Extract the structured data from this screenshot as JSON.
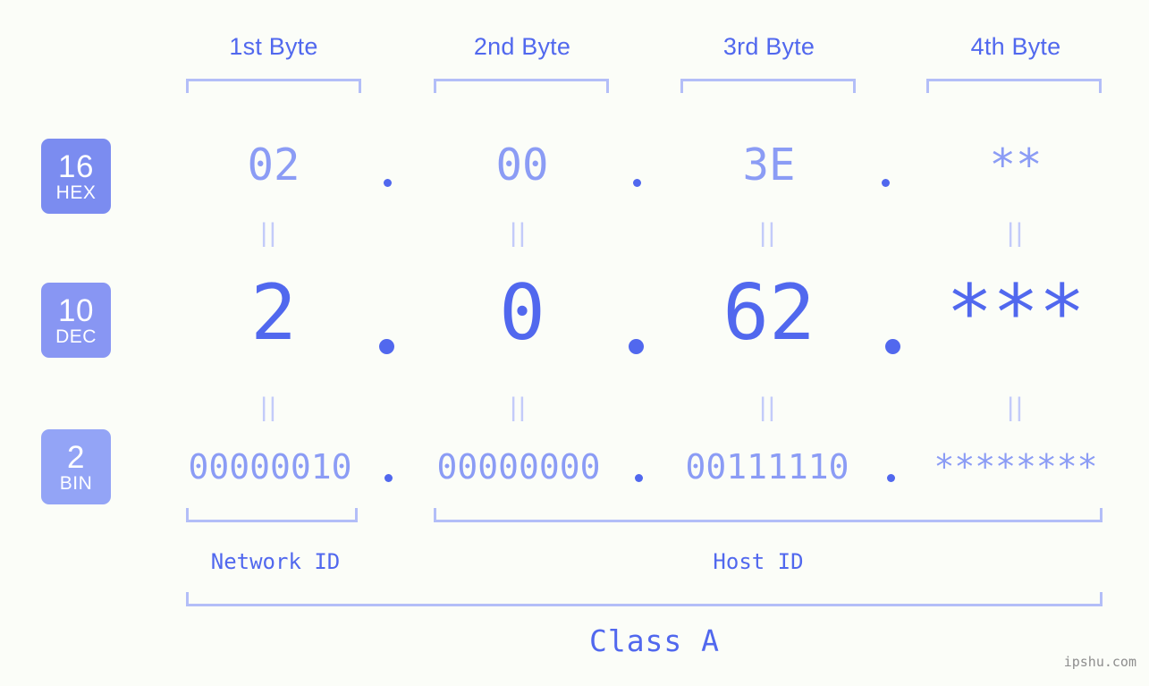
{
  "diagram": {
    "background_color": "#fbfdf8",
    "accent_color": "#5168ee",
    "accent_light_color": "#8b9cf5",
    "bracket_color": "#b3bef8",
    "watermark": "ipshu.com"
  },
  "byte_headers": [
    {
      "label": "1st Byte"
    },
    {
      "label": "2nd Byte"
    },
    {
      "label": "3rd Byte"
    },
    {
      "label": "4th Byte"
    }
  ],
  "bases": [
    {
      "id": "hex",
      "number": "16",
      "name": "HEX",
      "color": "#7b8cf0"
    },
    {
      "id": "dec",
      "number": "10",
      "name": "DEC",
      "color": "#8896f3"
    },
    {
      "id": "bin",
      "number": "2",
      "name": "BIN",
      "color": "#93a4f6"
    }
  ],
  "rows": {
    "hex": {
      "values": [
        "02",
        "00",
        "3E",
        "**"
      ],
      "separators": [
        ".",
        ".",
        "."
      ]
    },
    "dec": {
      "values": [
        "2",
        "0",
        "62",
        "***"
      ],
      "separators": [
        ".",
        ".",
        "."
      ]
    },
    "bin": {
      "values": [
        "00000010",
        "00000000",
        "00111110",
        "********"
      ],
      "separators": [
        ".",
        ".",
        "."
      ]
    }
  },
  "equals_connectors": {
    "glyph": "||",
    "count_per_row": 4
  },
  "segments": {
    "network_id": {
      "label": "Network ID"
    },
    "host_id": {
      "label": "Host ID"
    },
    "class": {
      "label": "Class A"
    }
  }
}
